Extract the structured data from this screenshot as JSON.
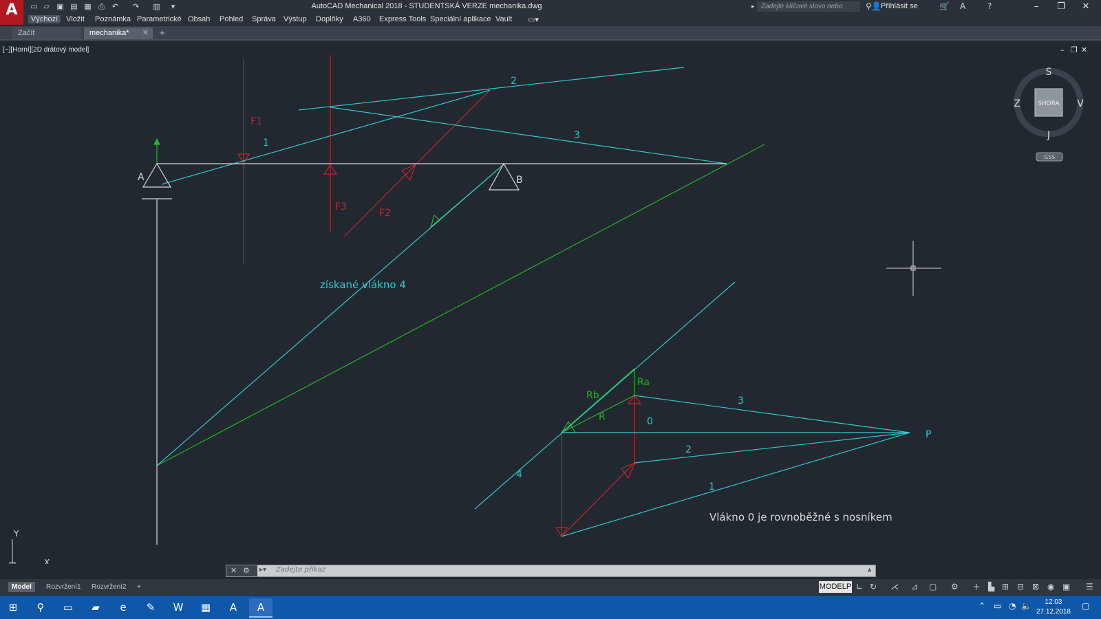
{
  "titlebar": {
    "title": "AutoCAD Mechanical 2018 - STUDENTSKÁ VERZE    mechanika.dwg",
    "search_placeholder": "Zadejte klíčové slovo nebo výraz",
    "signin": "Přihlásit se",
    "logo": "A"
  },
  "menu": [
    "Výchozí",
    "Vložit",
    "Poznámka",
    "Parametrické",
    "Obsah",
    "Pohled",
    "Správa",
    "Výstup",
    "Doplňky",
    "A360",
    "Express Tools",
    "Speciální aplikace",
    "Vault"
  ],
  "tabs": {
    "start": "Začít",
    "current": "mechanika*",
    "plus": "+"
  },
  "viewport": {
    "label": "[−][Horní][2D drátový model]"
  },
  "viewcube": {
    "north": "S",
    "south": "J",
    "east": "V",
    "west": "Z",
    "center": "SHORA",
    "wcs": "GSS"
  },
  "drawing": {
    "labels": {
      "A": "A",
      "B": "B",
      "F1": "F1",
      "F2": "F2",
      "F3": "F3",
      "top_1": "1",
      "top_2": "2",
      "top_3": "3",
      "fibre4": "získané vlákno 4",
      "Ra": "Ra",
      "Rb": "Rb",
      "R": "R",
      "zero": "0",
      "p3": "3",
      "p2": "2",
      "p1": "1",
      "p4": "4",
      "P": "P",
      "note": "Vlákno 0 je rovnoběžné s nosníkem"
    },
    "ucs": {
      "x": "X",
      "y": "Y"
    },
    "colors": {
      "cyan": "#33c7cc",
      "green": "#28b428",
      "red": "#c2262e",
      "white": "#d9d9d9"
    }
  },
  "command": {
    "placeholder": "Zadejte příkaz"
  },
  "layouts": [
    "Model",
    "Rozvržení1",
    "Rozvržení2",
    "+"
  ],
  "status": {
    "model": "MODELP"
  },
  "taskbar": {
    "time": "12:03",
    "date": "27.12.2018"
  }
}
